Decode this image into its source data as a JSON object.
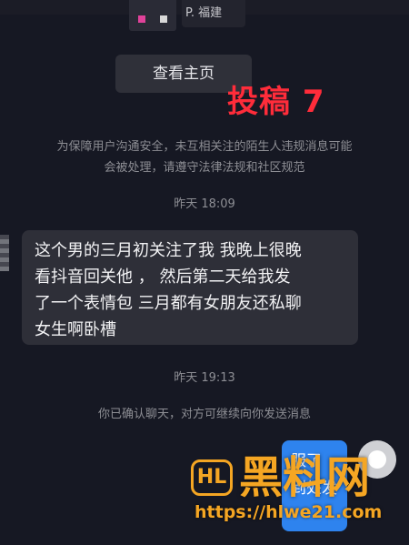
{
  "header": {
    "location_text": "P. 福建"
  },
  "home_button_label": "查看主页",
  "stamp_text": "投稿 7",
  "notice": {
    "line1": "为保障用户沟通安全，未互相关注的陌生人违规消息可能",
    "line2": "会被处理，请遵守法律法规和社区规范"
  },
  "messages": [
    {
      "timestamp": "昨天 18:09",
      "sender": "other",
      "lines": [
        "这个男的三月初关注了我 我晚上很晚",
        "看抖音回关他 ， 然后第二天给我发",
        "了一个表情包 三月都有女朋友还私聊",
        "女生啊卧槽"
      ]
    }
  ],
  "second_timestamp": "昨天 19:13",
  "confirm_text": "你已确认聊天，对方可继续向你发送消息",
  "my_message": {
    "line1": "服了",
    "line2": "到处发"
  },
  "watermark": {
    "logo": "HL",
    "title": "黑料网",
    "url": "https://hlwe21.com"
  },
  "colors": {
    "background": "#161823",
    "bubble_other": "#2e2f38",
    "bubble_self": "#2e83ee",
    "stamp_red": "#ff2c3a",
    "watermark_orange": "#f5a623"
  }
}
